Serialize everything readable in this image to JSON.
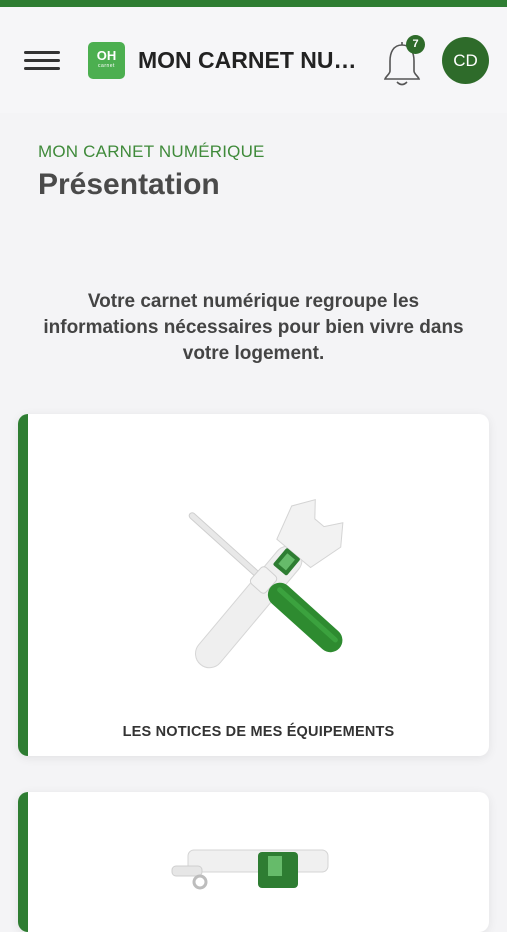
{
  "header": {
    "menu_icon": "hamburger-menu-icon",
    "logo": {
      "main": "OH",
      "sub": "carnet",
      "color": "#4caf50"
    },
    "title": "MON CARNET NUMÉRIQUE",
    "notifications": {
      "icon": "bell-icon",
      "count": "7"
    },
    "avatar_initials": "CD"
  },
  "page": {
    "eyebrow": "MON CARNET NUMÉRIQUE",
    "title": "Présentation",
    "intro": "Votre carnet numérique regroupe les informations nécessaires pour bien vivre dans votre logement."
  },
  "cards": [
    {
      "label": "LES NOTICES DE MES ÉQUIPEMENTS",
      "image": "wrench-screwdriver-illustration"
    },
    {
      "label": "",
      "image": "equipment-illustration"
    }
  ],
  "colors": {
    "accent": "#2e7d32",
    "accent_dark": "#2e6b2a",
    "eyebrow": "#3f8a3a",
    "background": "#f4f4f6"
  }
}
